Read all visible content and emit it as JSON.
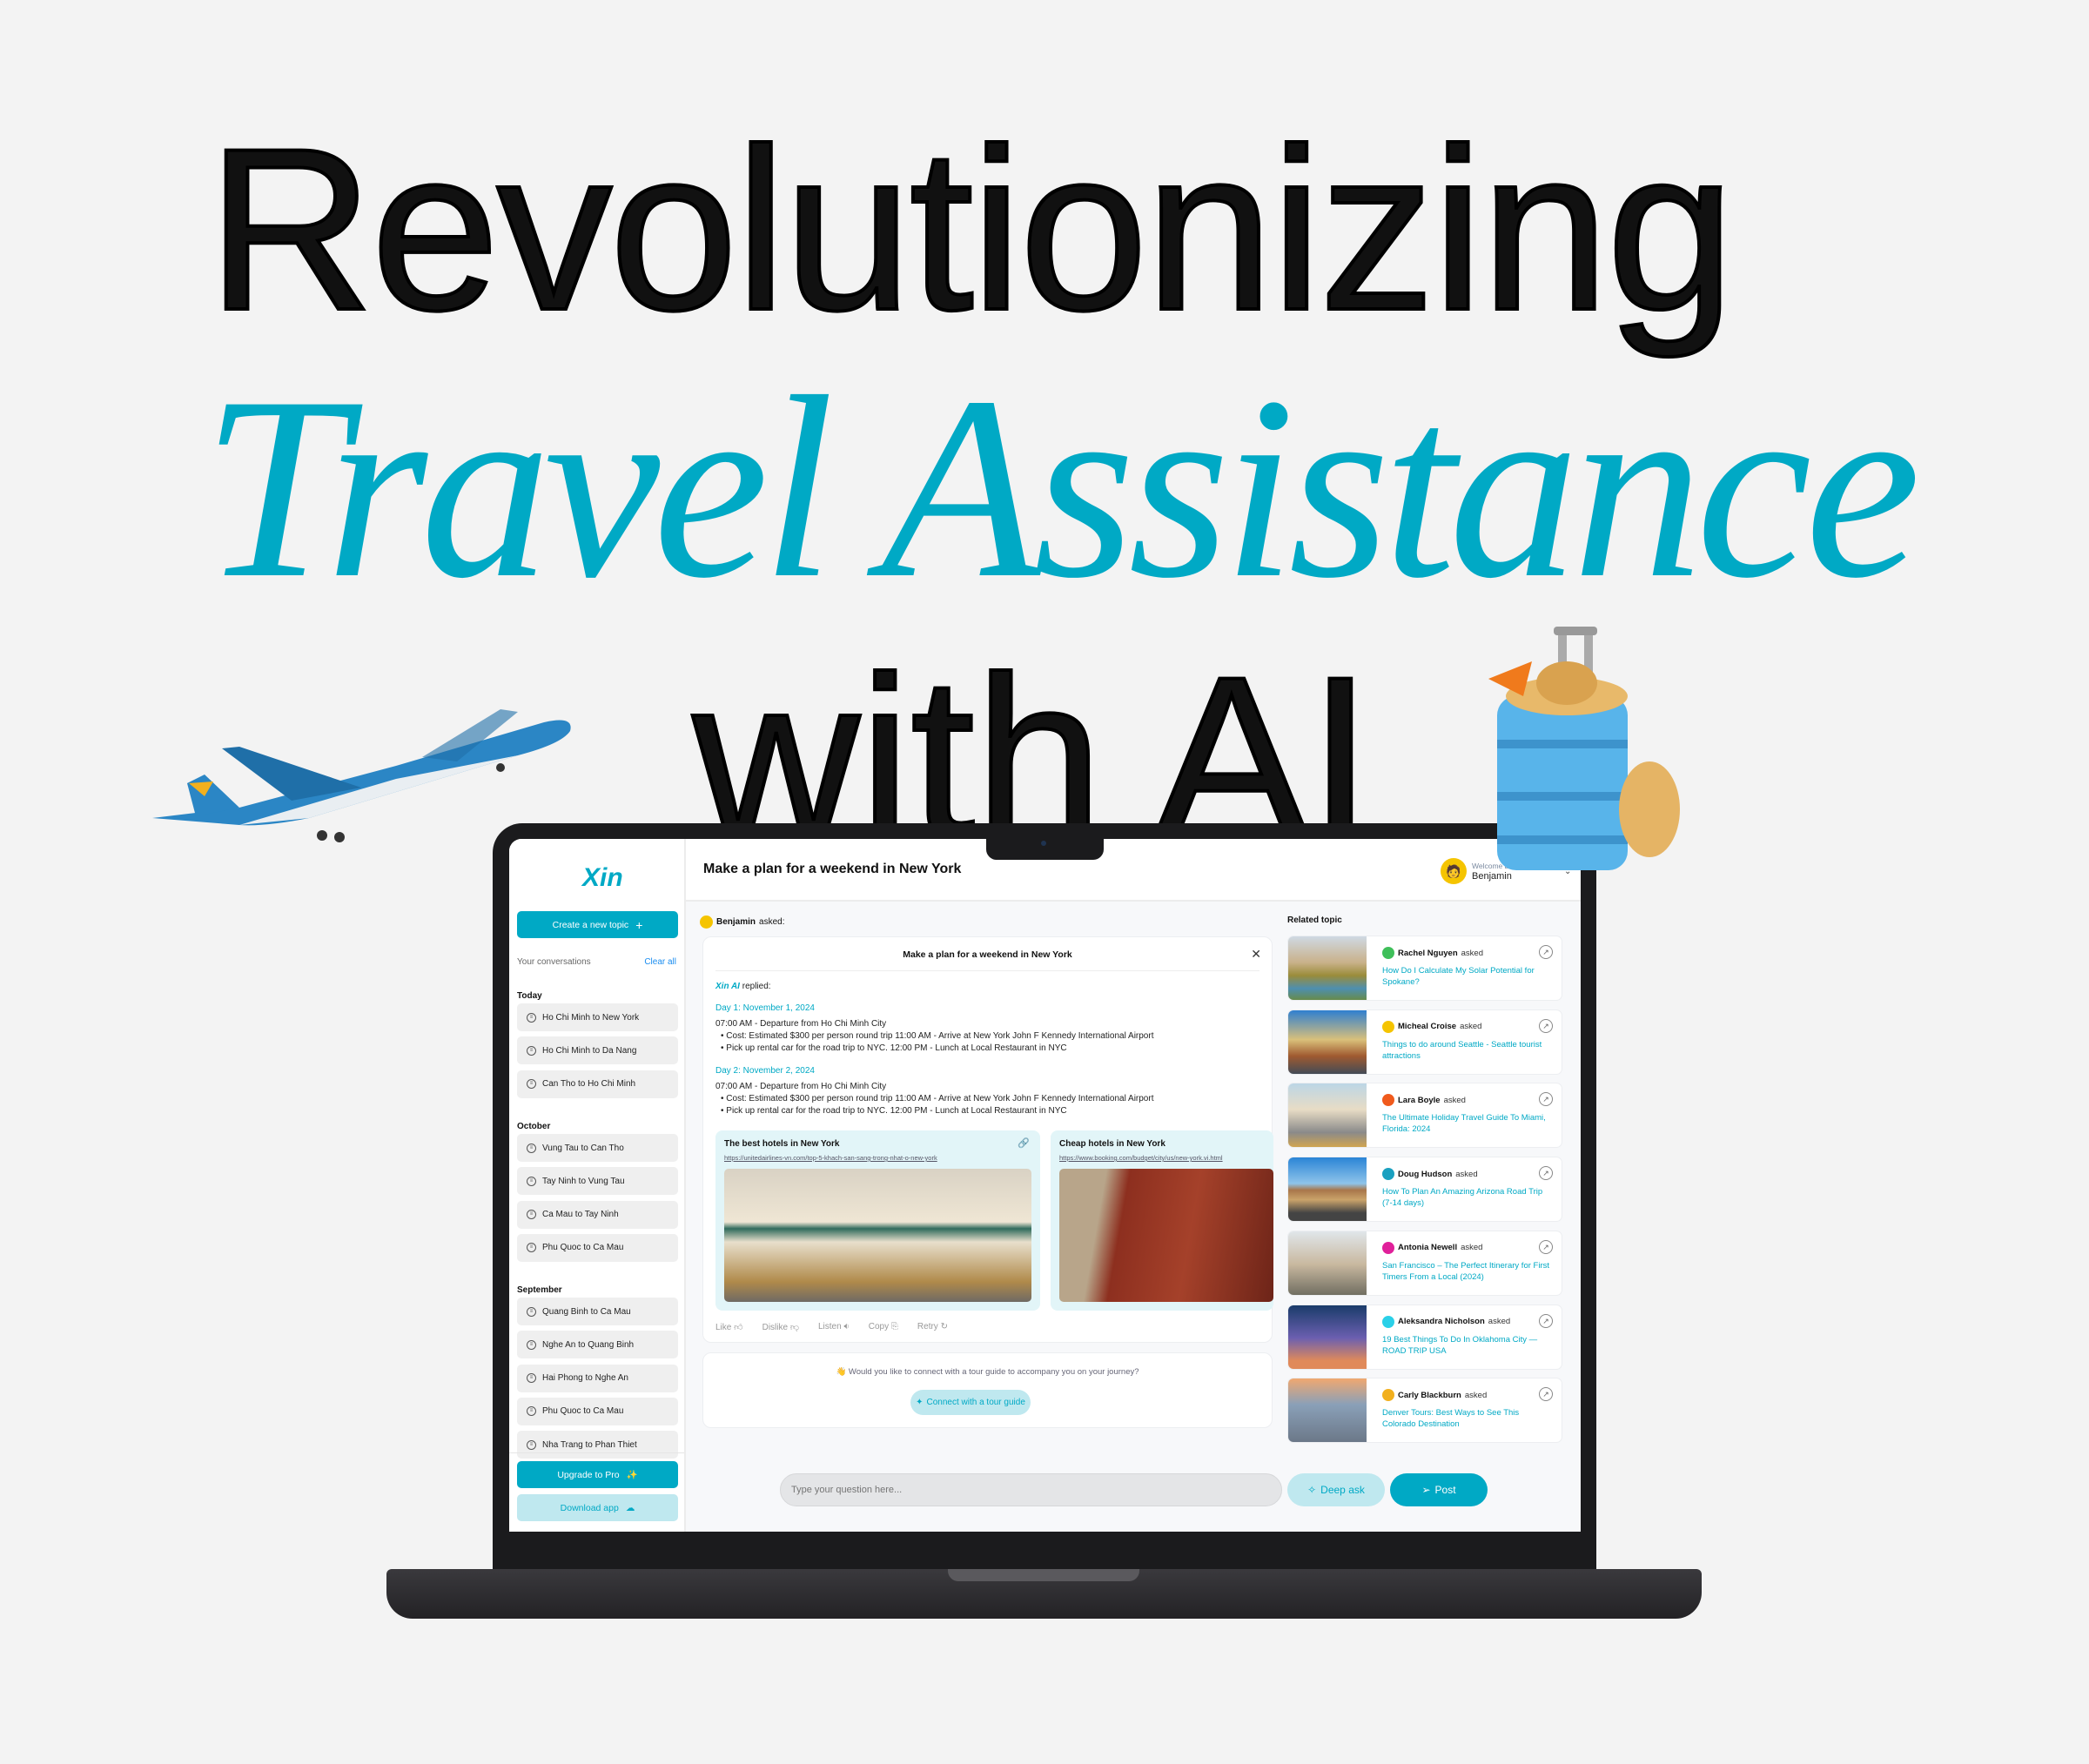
{
  "hero": {
    "line1": "Revolutionizing",
    "line2": "Travel Assistance",
    "line3": "with AI",
    "accent": "#00a9c5"
  },
  "app": {
    "logo": "Xin",
    "sidebar": {
      "create_label": "Create a new topic",
      "create_icon": "plus-icon",
      "conversations_label": "Your conversations",
      "clear_label": "Clear all",
      "groups": [
        {
          "label": "Today",
          "items": [
            "Ho Chi Minh to New York",
            "Ho Chi Minh to Da Nang",
            "Can Tho to Ho Chi Minh"
          ]
        },
        {
          "label": "October",
          "items": [
            "Vung Tau to Can Tho",
            "Tay Ninh to Vung Tau",
            "Ca Mau to Tay Ninh",
            "Phu Quoc to Ca Mau"
          ]
        },
        {
          "label": "September",
          "items": [
            "Quang Binh to Ca Mau",
            "Nghe An to Quang Binh",
            "Hai Phong to Nghe An",
            "Phu Quoc to Ca Mau",
            "Nha Trang to Phan Thiet"
          ]
        }
      ],
      "upgrade_label": "Upgrade to Pro",
      "upgrade_icon": "sparkles-icon",
      "download_label": "Download app",
      "download_icon": "cloud-download-icon"
    },
    "header": {
      "title": "Make a plan for a weekend in New York",
      "welcome": "Welcome back 👋",
      "user": "Benjamin"
    },
    "chat": {
      "asker": "Benjamin",
      "asked_suffix": "asked:",
      "card_title": "Make a plan for a weekend in New York",
      "ai_name": "Xin AI",
      "replied": "replied:",
      "days": [
        {
          "label": "Day 1: November 1, 2024",
          "line": "07:00 AM - Departure from Ho Chi Minh City",
          "bullets": [
            "Cost: Estimated $300 per person round trip 11:00 AM - Arrive at New York John F Kennedy International Airport",
            "Pick up rental car for the road trip to NYC. 12:00 PM - Lunch at Local Restaurant in NYC"
          ]
        },
        {
          "label": "Day 2: November 2, 2024",
          "line": "07:00 AM - Departure from Ho Chi Minh City",
          "bullets": [
            "Cost: Estimated $300 per person round trip 11:00 AM - Arrive at New York John F Kennedy International Airport",
            "Pick up rental car for the road trip to NYC. 12:00 PM - Lunch at Local Restaurant in NYC"
          ]
        }
      ],
      "hotels": [
        {
          "title": "The best hotels in New York",
          "url": "https://unitedairlines-vn.com/top-5-khach-san-sang-trong-nhat-o-new-york"
        },
        {
          "title": "Cheap hotels in New York",
          "url": "https://www.booking.com/budget/city/us/new-york.vi.html"
        }
      ],
      "actions": [
        "Like",
        "Dislike",
        "Listen",
        "Copy",
        "Retry"
      ],
      "tour_question": "👋 Would you like to connect with a tour guide to accompany you on your journey?",
      "tour_button": "Connect with a tour guide"
    },
    "composer": {
      "placeholder": "Type your question here...",
      "deep_ask": "Deep ask",
      "post": "Post"
    },
    "related": {
      "title": "Related topic",
      "asked": "asked",
      "items": [
        {
          "name": "Rachel Nguyen",
          "question": "How Do I Calculate My Solar Potential for Spokane?"
        },
        {
          "name": "Micheal Croise",
          "question": "Things to do around Seattle - Seattle tourist attractions"
        },
        {
          "name": "Lara Boyle",
          "question": "The Ultimate Holiday Travel Guide To Miami, Florida: 2024"
        },
        {
          "name": "Doug Hudson",
          "question": "How To Plan An Amazing Arizona Road Trip (7-14 days)"
        },
        {
          "name": "Antonia Newell",
          "question": "San Francisco – The Perfect Itinerary for First Timers From a Local (2024)"
        },
        {
          "name": "Aleksandra Nicholson",
          "question": "19 Best Things To Do In Oklahoma City — ROAD TRIP USA"
        },
        {
          "name": "Carly Blackburn",
          "question": "Denver Tours: Best Ways to See This Colorado Destination"
        }
      ]
    }
  }
}
